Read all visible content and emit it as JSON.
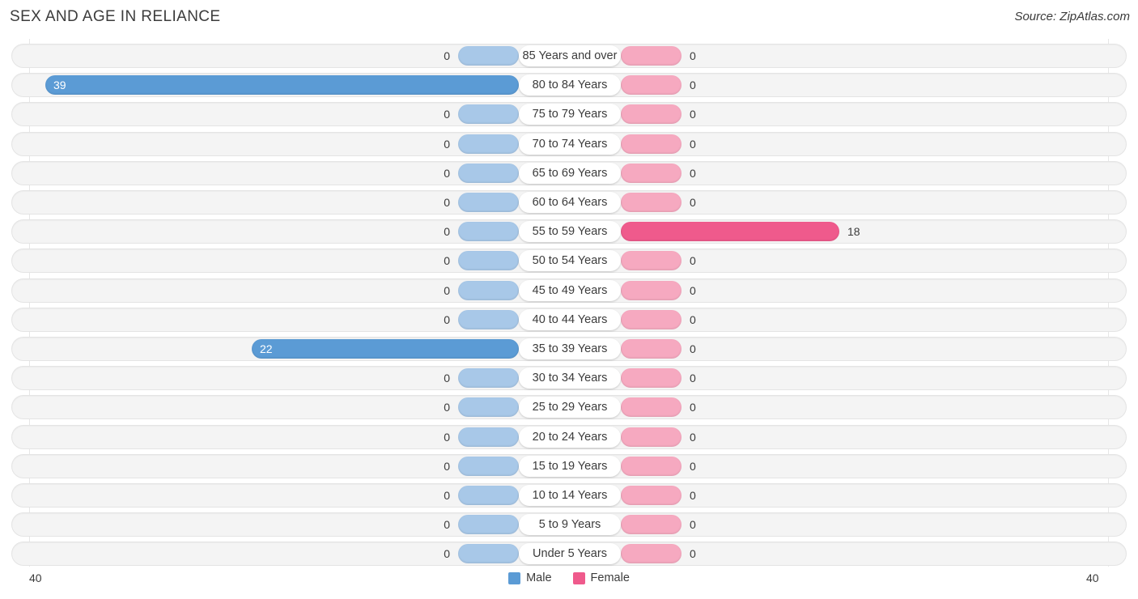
{
  "header": {
    "title": "SEX AND AGE IN RELIANCE",
    "source": "Source: ZipAtlas.com"
  },
  "legend": {
    "male_label": "Male",
    "female_label": "Female",
    "male_color": "#5b9bd5",
    "female_color": "#ef5a8c"
  },
  "axis": {
    "left_max_label": "40",
    "right_max_label": "40"
  },
  "chart_data": {
    "type": "bar",
    "title": "SEX AND AGE IN RELIANCE",
    "subtitle": "Source: ZipAtlas.com",
    "orientation": "horizontal",
    "style": "population-pyramid",
    "xlabel": "",
    "ylabel": "",
    "xlim": [
      40,
      40
    ],
    "grid": true,
    "legend_position": "bottom-center",
    "categories": [
      "85 Years and over",
      "80 to 84 Years",
      "75 to 79 Years",
      "70 to 74 Years",
      "65 to 69 Years",
      "60 to 64 Years",
      "55 to 59 Years",
      "50 to 54 Years",
      "45 to 49 Years",
      "40 to 44 Years",
      "35 to 39 Years",
      "30 to 34 Years",
      "25 to 29 Years",
      "20 to 24 Years",
      "15 to 19 Years",
      "10 to 14 Years",
      "5 to 9 Years",
      "Under 5 Years"
    ],
    "series": [
      {
        "name": "Male",
        "color": "#5b9bd5",
        "values": [
          0,
          39,
          0,
          0,
          0,
          0,
          0,
          0,
          0,
          0,
          22,
          0,
          0,
          0,
          0,
          0,
          0,
          0
        ]
      },
      {
        "name": "Female",
        "color": "#ef5a8c",
        "values": [
          0,
          0,
          0,
          0,
          0,
          0,
          18,
          0,
          0,
          0,
          0,
          0,
          0,
          0,
          0,
          0,
          0,
          0
        ]
      }
    ]
  },
  "rows": [
    {
      "age": "85 Years and over",
      "male": "0",
      "female": "0"
    },
    {
      "age": "80 to 84 Years",
      "male": "39",
      "female": "0"
    },
    {
      "age": "75 to 79 Years",
      "male": "0",
      "female": "0"
    },
    {
      "age": "70 to 74 Years",
      "male": "0",
      "female": "0"
    },
    {
      "age": "65 to 69 Years",
      "male": "0",
      "female": "0"
    },
    {
      "age": "60 to 64 Years",
      "male": "0",
      "female": "0"
    },
    {
      "age": "55 to 59 Years",
      "male": "0",
      "female": "18"
    },
    {
      "age": "50 to 54 Years",
      "male": "0",
      "female": "0"
    },
    {
      "age": "45 to 49 Years",
      "male": "0",
      "female": "0"
    },
    {
      "age": "40 to 44 Years",
      "male": "0",
      "female": "0"
    },
    {
      "age": "35 to 39 Years",
      "male": "22",
      "female": "0"
    },
    {
      "age": "30 to 34 Years",
      "male": "0",
      "female": "0"
    },
    {
      "age": "25 to 29 Years",
      "male": "0",
      "female": "0"
    },
    {
      "age": "20 to 24 Years",
      "male": "0",
      "female": "0"
    },
    {
      "age": "15 to 19 Years",
      "male": "0",
      "female": "0"
    },
    {
      "age": "10 to 14 Years",
      "male": "0",
      "female": "0"
    },
    {
      "age": "5 to 9 Years",
      "male": "0",
      "female": "0"
    },
    {
      "age": "Under 5 Years",
      "male": "0",
      "female": "0"
    }
  ]
}
